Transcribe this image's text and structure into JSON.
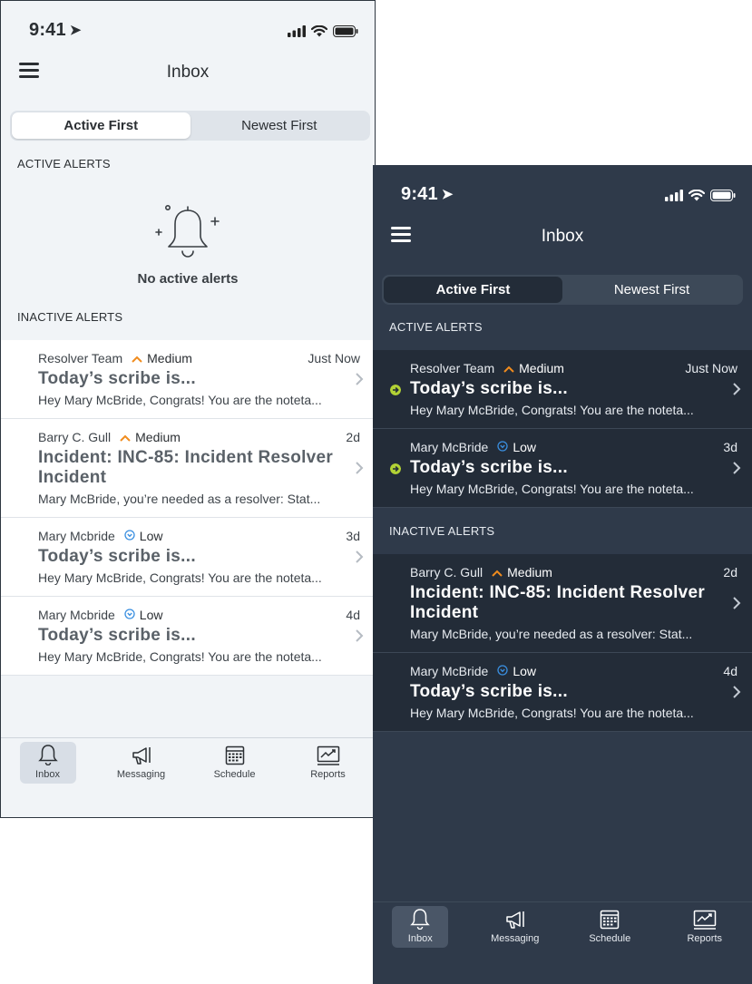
{
  "colors": {
    "medium": "#f08c1e",
    "low": "#3a8fe0",
    "active_indicator": "#b2d235"
  },
  "light": {
    "status": {
      "time": "9:41"
    },
    "header": {
      "title": "Inbox"
    },
    "segment": {
      "options": [
        "Active First",
        "Newest First"
      ],
      "selected": "Active First"
    },
    "active_section": {
      "heading": "ACTIVE ALERTS",
      "empty_text": "No active alerts"
    },
    "inactive_section": {
      "heading": "INACTIVE ALERTS"
    },
    "inactive_items": [
      {
        "sender": "Resolver Team",
        "priority": "Medium",
        "time": "Just Now",
        "title": "Today’s scribe is...",
        "body": "Hey Mary McBride, Congrats! You are the noteta..."
      },
      {
        "sender": "Barry C. Gull",
        "priority": "Medium",
        "time": "2d",
        "title": "Incident: INC-85: Incident Resolver Incident",
        "body": "Mary McBride, you’re needed as a resolver: Stat..."
      },
      {
        "sender": "Mary Mcbride",
        "priority": "Low",
        "time": "3d",
        "title": "Today’s scribe is...",
        "body": "Hey Mary McBride, Congrats! You are the noteta..."
      },
      {
        "sender": "Mary Mcbride",
        "priority": "Low",
        "time": "4d",
        "title": "Today’s scribe is...",
        "body": "Hey Mary McBride, Congrats! You are the noteta..."
      }
    ],
    "tabs": [
      {
        "label": "Inbox",
        "icon": "bell-icon",
        "active": true
      },
      {
        "label": "Messaging",
        "icon": "megaphone-icon",
        "active": false
      },
      {
        "label": "Schedule",
        "icon": "calendar-icon",
        "active": false
      },
      {
        "label": "Reports",
        "icon": "chart-icon",
        "active": false
      }
    ]
  },
  "dark": {
    "status": {
      "time": "9:41"
    },
    "header": {
      "title": "Inbox"
    },
    "segment": {
      "options": [
        "Active First",
        "Newest First"
      ],
      "selected": "Active First"
    },
    "active_section": {
      "heading": "ACTIVE ALERTS"
    },
    "active_items": [
      {
        "sender": "Resolver Team",
        "priority": "Medium",
        "time": "Just Now",
        "title": "Today’s scribe is...",
        "body": "Hey Mary McBride, Congrats! You are the noteta..."
      },
      {
        "sender": "Mary McBride",
        "priority": "Low",
        "time": "3d",
        "title": "Today’s scribe is...",
        "body": "Hey Mary McBride, Congrats! You are the noteta..."
      }
    ],
    "inactive_section": {
      "heading": "INACTIVE ALERTS"
    },
    "inactive_items": [
      {
        "sender": "Barry C. Gull",
        "priority": "Medium",
        "time": "2d",
        "title": "Incident: INC-85: Incident Resolver Incident",
        "body": "Mary McBride, you’re needed as a resolver: Stat..."
      },
      {
        "sender": "Mary McBride",
        "priority": "Low",
        "time": "4d",
        "title": "Today’s scribe is...",
        "body": "Hey Mary McBride, Congrats! You are the noteta..."
      }
    ],
    "tabs": [
      {
        "label": "Inbox",
        "icon": "bell-icon",
        "active": true
      },
      {
        "label": "Messaging",
        "icon": "megaphone-icon",
        "active": false
      },
      {
        "label": "Schedule",
        "icon": "calendar-icon",
        "active": false
      },
      {
        "label": "Reports",
        "icon": "chart-icon",
        "active": false
      }
    ]
  }
}
